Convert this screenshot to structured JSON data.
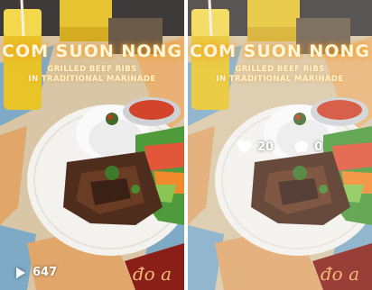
{
  "tiles": [
    {
      "id": "left",
      "title": "COM SUON NONG",
      "subtitle_line1": "GRILLED BEEF RIBS",
      "subtitle_line2": "IN TRADITIONAL MARINADE",
      "views": "647",
      "watermark": "đo a"
    },
    {
      "id": "right",
      "title": "COM SUON NONG",
      "subtitle_line1": "GRILLED BEEF RIBS",
      "subtitle_line2": "IN TRADITIONAL MARINADE",
      "likes": "20",
      "comments": "0",
      "watermark": "đo a"
    }
  ],
  "icons": {
    "views": "play-icon",
    "likes": "heart-icon",
    "comments": "comment-bubble-icon"
  },
  "colors": {
    "title_glow": "#f5aa28",
    "drink": "#e8c428",
    "tablecloth_blue": "#7faac6",
    "tablecloth_orange": "#e0a66a",
    "plate": "#f4f2ee",
    "sauce": "#d2452c"
  }
}
